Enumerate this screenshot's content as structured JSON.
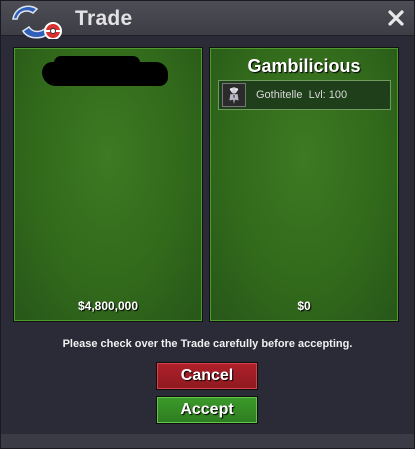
{
  "window": {
    "title": "Trade",
    "accent": "#2d7c20"
  },
  "left_panel": {
    "money": "$4,800,000"
  },
  "right_panel": {
    "owner": "Gambilicious",
    "item": {
      "name": "Gothitelle",
      "level": "Lvl: 100",
      "icon": "pokemon-sprite-icon"
    },
    "money": "$0"
  },
  "notice": "Please check over the Trade carefully before accepting.",
  "buttons": {
    "cancel": "Cancel",
    "accept": "Accept",
    "cancel_color": "#b0202a",
    "accept_color": "#3c9a2a"
  }
}
